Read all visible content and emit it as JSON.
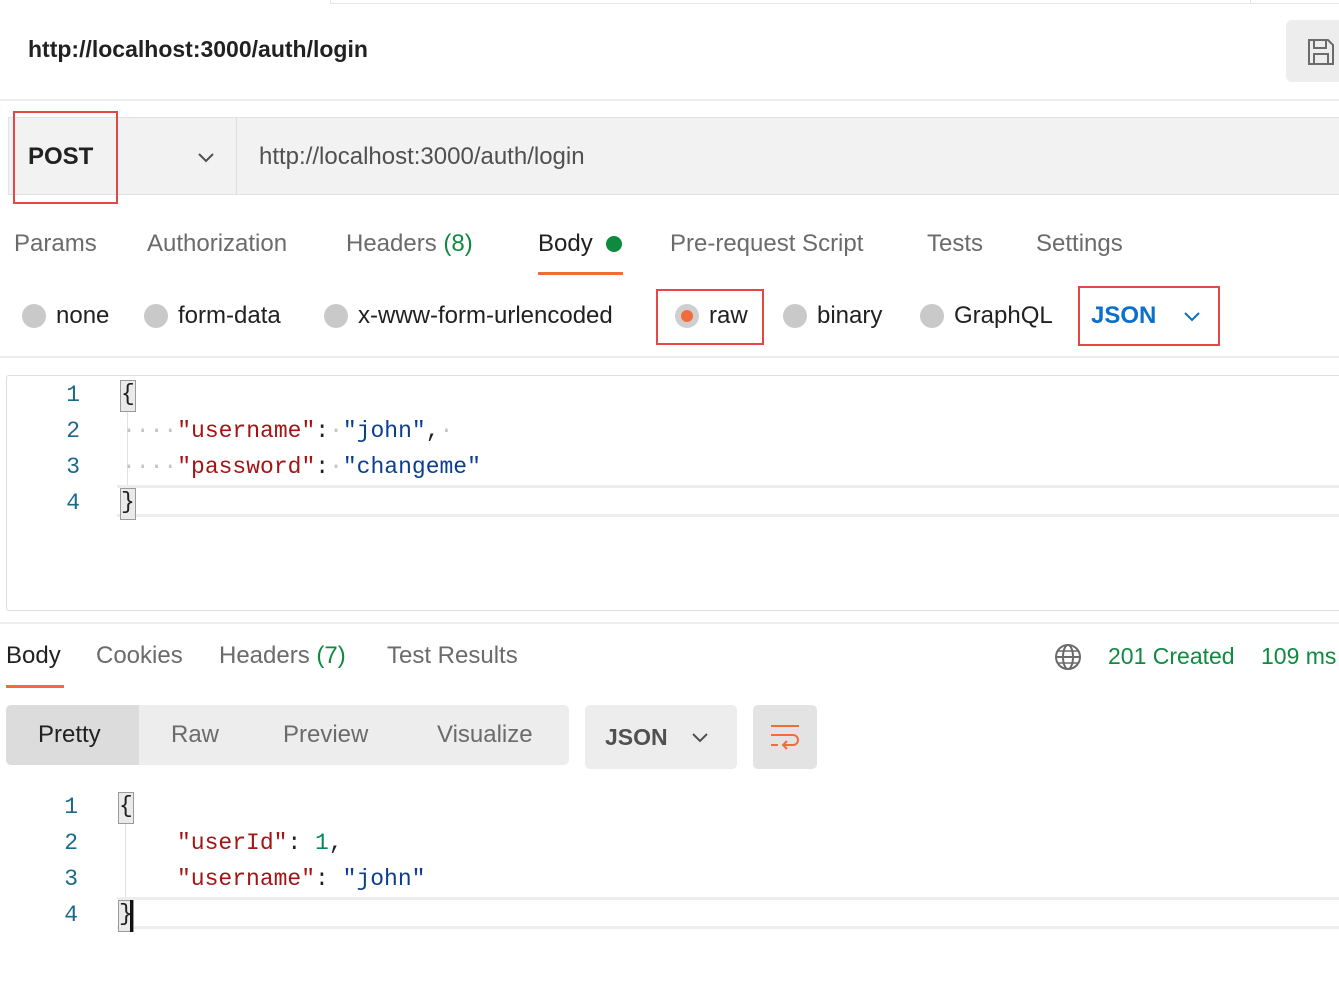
{
  "request": {
    "title": "http://localhost:3000/auth/login",
    "save_icon": "save-icon",
    "method": "POST",
    "url": "http://localhost:3000/auth/login"
  },
  "request_tabs": {
    "params": "Params",
    "authorization": "Authorization",
    "headers": "Headers",
    "headers_count": "(8)",
    "body": "Body",
    "prerequest": "Pre-request Script",
    "tests": "Tests",
    "settings": "Settings",
    "active": "Body"
  },
  "body_types": {
    "none": "none",
    "form_data": "form-data",
    "urlencoded": "x-www-form-urlencoded",
    "raw": "raw",
    "binary": "binary",
    "graphql": "GraphQL",
    "selected": "raw",
    "language": "JSON"
  },
  "request_body": {
    "line_numbers": [
      "1",
      "2",
      "3",
      "4"
    ],
    "open_brace": "{",
    "close_brace": "}",
    "username_key": "\"username\"",
    "username_value": "\"john\"",
    "password_key": "\"password\"",
    "password_value": "\"changeme\""
  },
  "response_tabs": {
    "body": "Body",
    "cookies": "Cookies",
    "headers": "Headers",
    "headers_count": "(7)",
    "test_results": "Test Results",
    "active": "Body"
  },
  "response_status": {
    "status": "201 Created",
    "time": "109 ms",
    "status_color": "#0f8a40"
  },
  "response_view": {
    "pretty": "Pretty",
    "raw": "Raw",
    "preview": "Preview",
    "visualize": "Visualize",
    "active": "Pretty",
    "format": "JSON"
  },
  "response_body": {
    "line_numbers": [
      "1",
      "2",
      "3",
      "4"
    ],
    "open_brace": "{",
    "close_brace": "}",
    "userid_key": "\"userId\"",
    "userid_value": "1",
    "username_key": "\"username\"",
    "username_value": "\"john\""
  },
  "colors": {
    "accent_orange": "#f26b3a",
    "highlight_red": "#e64646",
    "link_blue": "#0b6fcc",
    "success_green": "#0f8a40"
  }
}
